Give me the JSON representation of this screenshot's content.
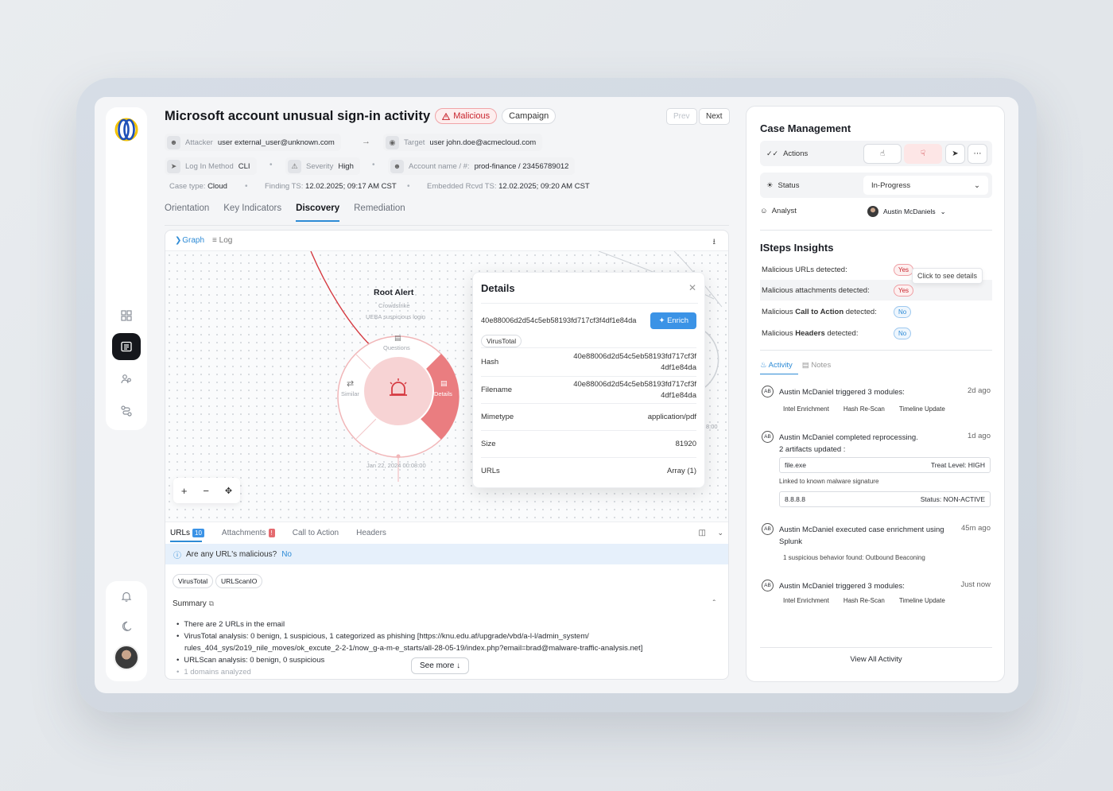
{
  "sidebar": {
    "nav_icons": [
      "dashboard-icon",
      "cases-icon",
      "users-icon",
      "flows-icon"
    ],
    "bottom_icons": [
      "bell-icon",
      "moon-icon"
    ]
  },
  "header": {
    "title": "Microsoft account unusual sign-in activity",
    "badge_malicious": "Malicious",
    "badge_campaign": "Campaign",
    "prev": "Prev",
    "next": "Next"
  },
  "meta": {
    "attacker_label": "Attacker",
    "attacker_value": "user external_user@unknown.com",
    "target_label": "Target",
    "target_value": "user john.doe@acmecloud.com",
    "login_label": "Log In Method",
    "login_value": "CLI",
    "severity_label": "Severity",
    "severity_value": "High",
    "account_label": "Account name / #:",
    "account_value": "prod-finance / 23456789012",
    "case_type_label": "Case type:",
    "case_type_value": "Cloud",
    "finding_label": "Finding TS:",
    "finding_value": "12.02.2025; 09:17 AM CST",
    "embedded_label": "Embedded Rcvd TS:",
    "embedded_value": "12.02.2025; 09:20 AM CST"
  },
  "tabs": [
    "Orientation",
    "Key Indicators",
    "Discovery",
    "Remediation"
  ],
  "graph": {
    "graph_tab": "Graph",
    "log_tab": "Log",
    "root_alert": "Root Alert",
    "root_source": "Crowdstrike",
    "root_desc": "UEBA suspicious login",
    "questions": "Questions",
    "similar": "Similar",
    "details_seg": "Details",
    "timestamp": "Jan 22, 2024 00:08:00",
    "side_time": "8:00"
  },
  "details": {
    "title": "Details",
    "sha": "40e88006d2d54c5eb58193fd717cf3f4df1e84da",
    "enrich": "Enrich",
    "source_chip": "VirusTotal",
    "rows": [
      {
        "key": "Hash",
        "value1": "40e88006d2d54c5eb58193fd717cf3f",
        "value2": "4df1e84da"
      },
      {
        "key": "Filename",
        "value1": "40e88006d2d54c5eb58193fd717cf3f",
        "value2": "4df1e84da"
      },
      {
        "key": "Mimetype",
        "value1": "application/pdf",
        "value2": ""
      },
      {
        "key": "Size",
        "value1": "81920",
        "value2": ""
      },
      {
        "key": "URLs",
        "value1": "Array (1)",
        "value2": ""
      }
    ]
  },
  "bottom": {
    "tabs": [
      {
        "label": "URLs",
        "count": "10"
      },
      {
        "label": "Attachments",
        "count": "!"
      },
      {
        "label": "Call to Action",
        "count": ""
      },
      {
        "label": "Headers",
        "count": ""
      }
    ],
    "question": "Are any URL's malicious?",
    "answer": "No",
    "chips": [
      "VirusTotal",
      "URLScanIO"
    ],
    "summary_label": "Summary",
    "summary": [
      "There are 2 URLs in the email",
      "VirusTotal analysis: 0 benign, 1 suspicious, 1 categorized as phishing [https://knu.edu.af/upgrade/vbd/a-l-l/admin_system/",
      "rules_404_sys/2o19_nile_moves/ok_excute_2-2-1/now_g-a-m-e_starts/all-28-05-19/index.php?email=brad@malware-traffic-analysis.net]",
      "URLScan analysis: 0 benign, 0 suspicious",
      "1 domains analyzed"
    ],
    "see_more": "See more"
  },
  "case_management": {
    "title": "Case Management",
    "actions_label": "Actions",
    "status_label": "Status",
    "status_value": "In-Progress",
    "analyst_label": "Analyst",
    "analyst_value": "Austin McDaniels"
  },
  "insights": {
    "title": "ISteps Insights",
    "rows": [
      {
        "pre": "Malicious URLs detected:",
        "bold": "",
        "post": "",
        "value": "Yes"
      },
      {
        "pre": "Malicious attachments detected:",
        "bold": "",
        "post": "",
        "value": "Yes"
      },
      {
        "pre": "Malicious ",
        "bold": "Call to Action",
        "post": " detected:",
        "value": "No"
      },
      {
        "pre": "Malicious ",
        "bold": "Headers",
        "post": " detected:",
        "value": "No"
      }
    ],
    "tooltip": "Click to see details"
  },
  "activity": {
    "tab_activity": "Activity",
    "tab_notes": "Notes",
    "initials": "AB",
    "events": [
      {
        "text": "Austin McDaniel triggered 3 modules:",
        "text2": "",
        "when": "2d ago",
        "modules": [
          "Intel Enrichment",
          "Hash Re-Scan",
          "Timeline Update"
        ]
      },
      {
        "text": "Austin McDaniel completed reprocessing.",
        "text2": "2 artifacts updated :",
        "when": "1d ago",
        "artifact1_name": "file.exe",
        "artifact1_status": "Treat Level: HIGH",
        "artifact_note": "Linked to known malware signature",
        "artifact2_name": "8.8.8.8",
        "artifact2_status": "Status: NON-ACTIVE"
      },
      {
        "text": "Austin McDaniel executed case enrichment using",
        "text2": "Splunk",
        "when": "45m ago",
        "note": "1 suspicious behavior found: Outbound Beaconing"
      },
      {
        "text": "Austin McDaniel triggered 3 modules:",
        "text2": "",
        "when": "Just now",
        "modules": [
          "Intel Enrichment",
          "Hash Re-Scan",
          "Timeline Update"
        ]
      }
    ],
    "view_all": "View All Activity"
  },
  "colors": {
    "accent": "#2e8bd6",
    "danger": "#c8232c",
    "alert_core": "#f3c6c8",
    "alert_segment": "#ea7d80"
  }
}
